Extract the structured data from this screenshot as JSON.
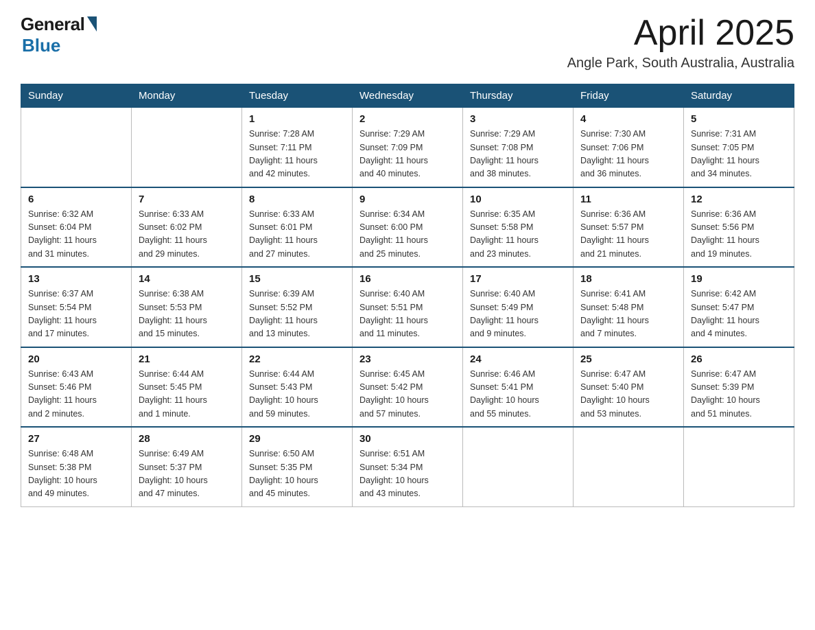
{
  "header": {
    "logo_general": "General",
    "logo_blue": "Blue",
    "month_title": "April 2025",
    "location": "Angle Park, South Australia, Australia"
  },
  "weekdays": [
    "Sunday",
    "Monday",
    "Tuesday",
    "Wednesday",
    "Thursday",
    "Friday",
    "Saturday"
  ],
  "weeks": [
    [
      {
        "day": "",
        "info": ""
      },
      {
        "day": "",
        "info": ""
      },
      {
        "day": "1",
        "info": "Sunrise: 7:28 AM\nSunset: 7:11 PM\nDaylight: 11 hours\nand 42 minutes."
      },
      {
        "day": "2",
        "info": "Sunrise: 7:29 AM\nSunset: 7:09 PM\nDaylight: 11 hours\nand 40 minutes."
      },
      {
        "day": "3",
        "info": "Sunrise: 7:29 AM\nSunset: 7:08 PM\nDaylight: 11 hours\nand 38 minutes."
      },
      {
        "day": "4",
        "info": "Sunrise: 7:30 AM\nSunset: 7:06 PM\nDaylight: 11 hours\nand 36 minutes."
      },
      {
        "day": "5",
        "info": "Sunrise: 7:31 AM\nSunset: 7:05 PM\nDaylight: 11 hours\nand 34 minutes."
      }
    ],
    [
      {
        "day": "6",
        "info": "Sunrise: 6:32 AM\nSunset: 6:04 PM\nDaylight: 11 hours\nand 31 minutes."
      },
      {
        "day": "7",
        "info": "Sunrise: 6:33 AM\nSunset: 6:02 PM\nDaylight: 11 hours\nand 29 minutes."
      },
      {
        "day": "8",
        "info": "Sunrise: 6:33 AM\nSunset: 6:01 PM\nDaylight: 11 hours\nand 27 minutes."
      },
      {
        "day": "9",
        "info": "Sunrise: 6:34 AM\nSunset: 6:00 PM\nDaylight: 11 hours\nand 25 minutes."
      },
      {
        "day": "10",
        "info": "Sunrise: 6:35 AM\nSunset: 5:58 PM\nDaylight: 11 hours\nand 23 minutes."
      },
      {
        "day": "11",
        "info": "Sunrise: 6:36 AM\nSunset: 5:57 PM\nDaylight: 11 hours\nand 21 minutes."
      },
      {
        "day": "12",
        "info": "Sunrise: 6:36 AM\nSunset: 5:56 PM\nDaylight: 11 hours\nand 19 minutes."
      }
    ],
    [
      {
        "day": "13",
        "info": "Sunrise: 6:37 AM\nSunset: 5:54 PM\nDaylight: 11 hours\nand 17 minutes."
      },
      {
        "day": "14",
        "info": "Sunrise: 6:38 AM\nSunset: 5:53 PM\nDaylight: 11 hours\nand 15 minutes."
      },
      {
        "day": "15",
        "info": "Sunrise: 6:39 AM\nSunset: 5:52 PM\nDaylight: 11 hours\nand 13 minutes."
      },
      {
        "day": "16",
        "info": "Sunrise: 6:40 AM\nSunset: 5:51 PM\nDaylight: 11 hours\nand 11 minutes."
      },
      {
        "day": "17",
        "info": "Sunrise: 6:40 AM\nSunset: 5:49 PM\nDaylight: 11 hours\nand 9 minutes."
      },
      {
        "day": "18",
        "info": "Sunrise: 6:41 AM\nSunset: 5:48 PM\nDaylight: 11 hours\nand 7 minutes."
      },
      {
        "day": "19",
        "info": "Sunrise: 6:42 AM\nSunset: 5:47 PM\nDaylight: 11 hours\nand 4 minutes."
      }
    ],
    [
      {
        "day": "20",
        "info": "Sunrise: 6:43 AM\nSunset: 5:46 PM\nDaylight: 11 hours\nand 2 minutes."
      },
      {
        "day": "21",
        "info": "Sunrise: 6:44 AM\nSunset: 5:45 PM\nDaylight: 11 hours\nand 1 minute."
      },
      {
        "day": "22",
        "info": "Sunrise: 6:44 AM\nSunset: 5:43 PM\nDaylight: 10 hours\nand 59 minutes."
      },
      {
        "day": "23",
        "info": "Sunrise: 6:45 AM\nSunset: 5:42 PM\nDaylight: 10 hours\nand 57 minutes."
      },
      {
        "day": "24",
        "info": "Sunrise: 6:46 AM\nSunset: 5:41 PM\nDaylight: 10 hours\nand 55 minutes."
      },
      {
        "day": "25",
        "info": "Sunrise: 6:47 AM\nSunset: 5:40 PM\nDaylight: 10 hours\nand 53 minutes."
      },
      {
        "day": "26",
        "info": "Sunrise: 6:47 AM\nSunset: 5:39 PM\nDaylight: 10 hours\nand 51 minutes."
      }
    ],
    [
      {
        "day": "27",
        "info": "Sunrise: 6:48 AM\nSunset: 5:38 PM\nDaylight: 10 hours\nand 49 minutes."
      },
      {
        "day": "28",
        "info": "Sunrise: 6:49 AM\nSunset: 5:37 PM\nDaylight: 10 hours\nand 47 minutes."
      },
      {
        "day": "29",
        "info": "Sunrise: 6:50 AM\nSunset: 5:35 PM\nDaylight: 10 hours\nand 45 minutes."
      },
      {
        "day": "30",
        "info": "Sunrise: 6:51 AM\nSunset: 5:34 PM\nDaylight: 10 hours\nand 43 minutes."
      },
      {
        "day": "",
        "info": ""
      },
      {
        "day": "",
        "info": ""
      },
      {
        "day": "",
        "info": ""
      }
    ]
  ]
}
